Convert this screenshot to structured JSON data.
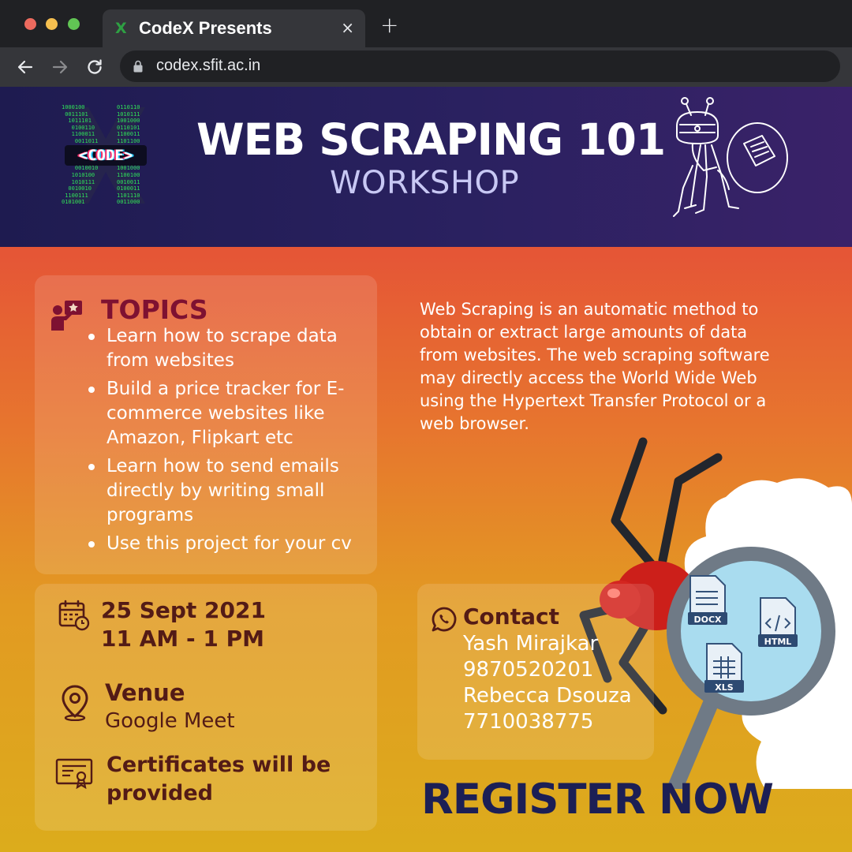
{
  "browser": {
    "tab_title": "CodeX Presents",
    "tab_favicon": "X",
    "close_label": "×",
    "new_tab_label": "+",
    "url": "codex.sfit.ac.in"
  },
  "header": {
    "logo_text": "<CODE>",
    "binary_left": "1000100\n 0011101\n  1011101\n   0100110\n   1100011\n    0011011\n     1110001\n\n     1000111\n    0010010\n   1010100\n   1010111\n  0010010\n 1100111\n0101001",
    "binary_right": "0110110\n1010111\n1001000\n0110101\n1100011\n1101100\n1000111\n\n0010101\n1001000\n1100100\n0010011\n0100011\n1101110\n0011000",
    "title": "WEB SCRAPING 101",
    "subtitle": "WORKSHOP"
  },
  "topics": {
    "heading": "TOPICS",
    "items": [
      "Learn how to scrape data from websites",
      "Build  a price tracker for E-commerce websites like Amazon, Flipkart etc",
      "Learn how to send emails directly by writing small programs",
      "Use this project for your cv"
    ]
  },
  "description": "Web Scraping is an automatic method to obtain or extract large amounts of data from websites. The web scraping software may directly access the World Wide Web using the Hypertext Transfer Protocol or a web browser.",
  "event": {
    "date": "25 Sept 2021",
    "time": "11 AM - 1 PM",
    "venue_label": "Venue",
    "venue_value": "Google Meet",
    "certificates": "Certificates will be provided"
  },
  "contact": {
    "heading": "Contact",
    "lines": [
      "Yash Mirajkar",
      "9870520201",
      "Rebecca Dsouza",
      "7710038775"
    ]
  },
  "file_labels": [
    "DOCX",
    "HTML",
    "XLS"
  ],
  "cta": "REGISTER NOW",
  "icons": {
    "calendar": "calendar-icon",
    "location": "location-pin-icon",
    "certificate": "certificate-icon",
    "whatsapp": "whatsapp-icon",
    "topics": "presenter-icon"
  },
  "colors": {
    "header_bg": "#25205a",
    "accent_dark": "#531b16",
    "topics_heading": "#7e1131",
    "cta": "#1c1f55"
  }
}
